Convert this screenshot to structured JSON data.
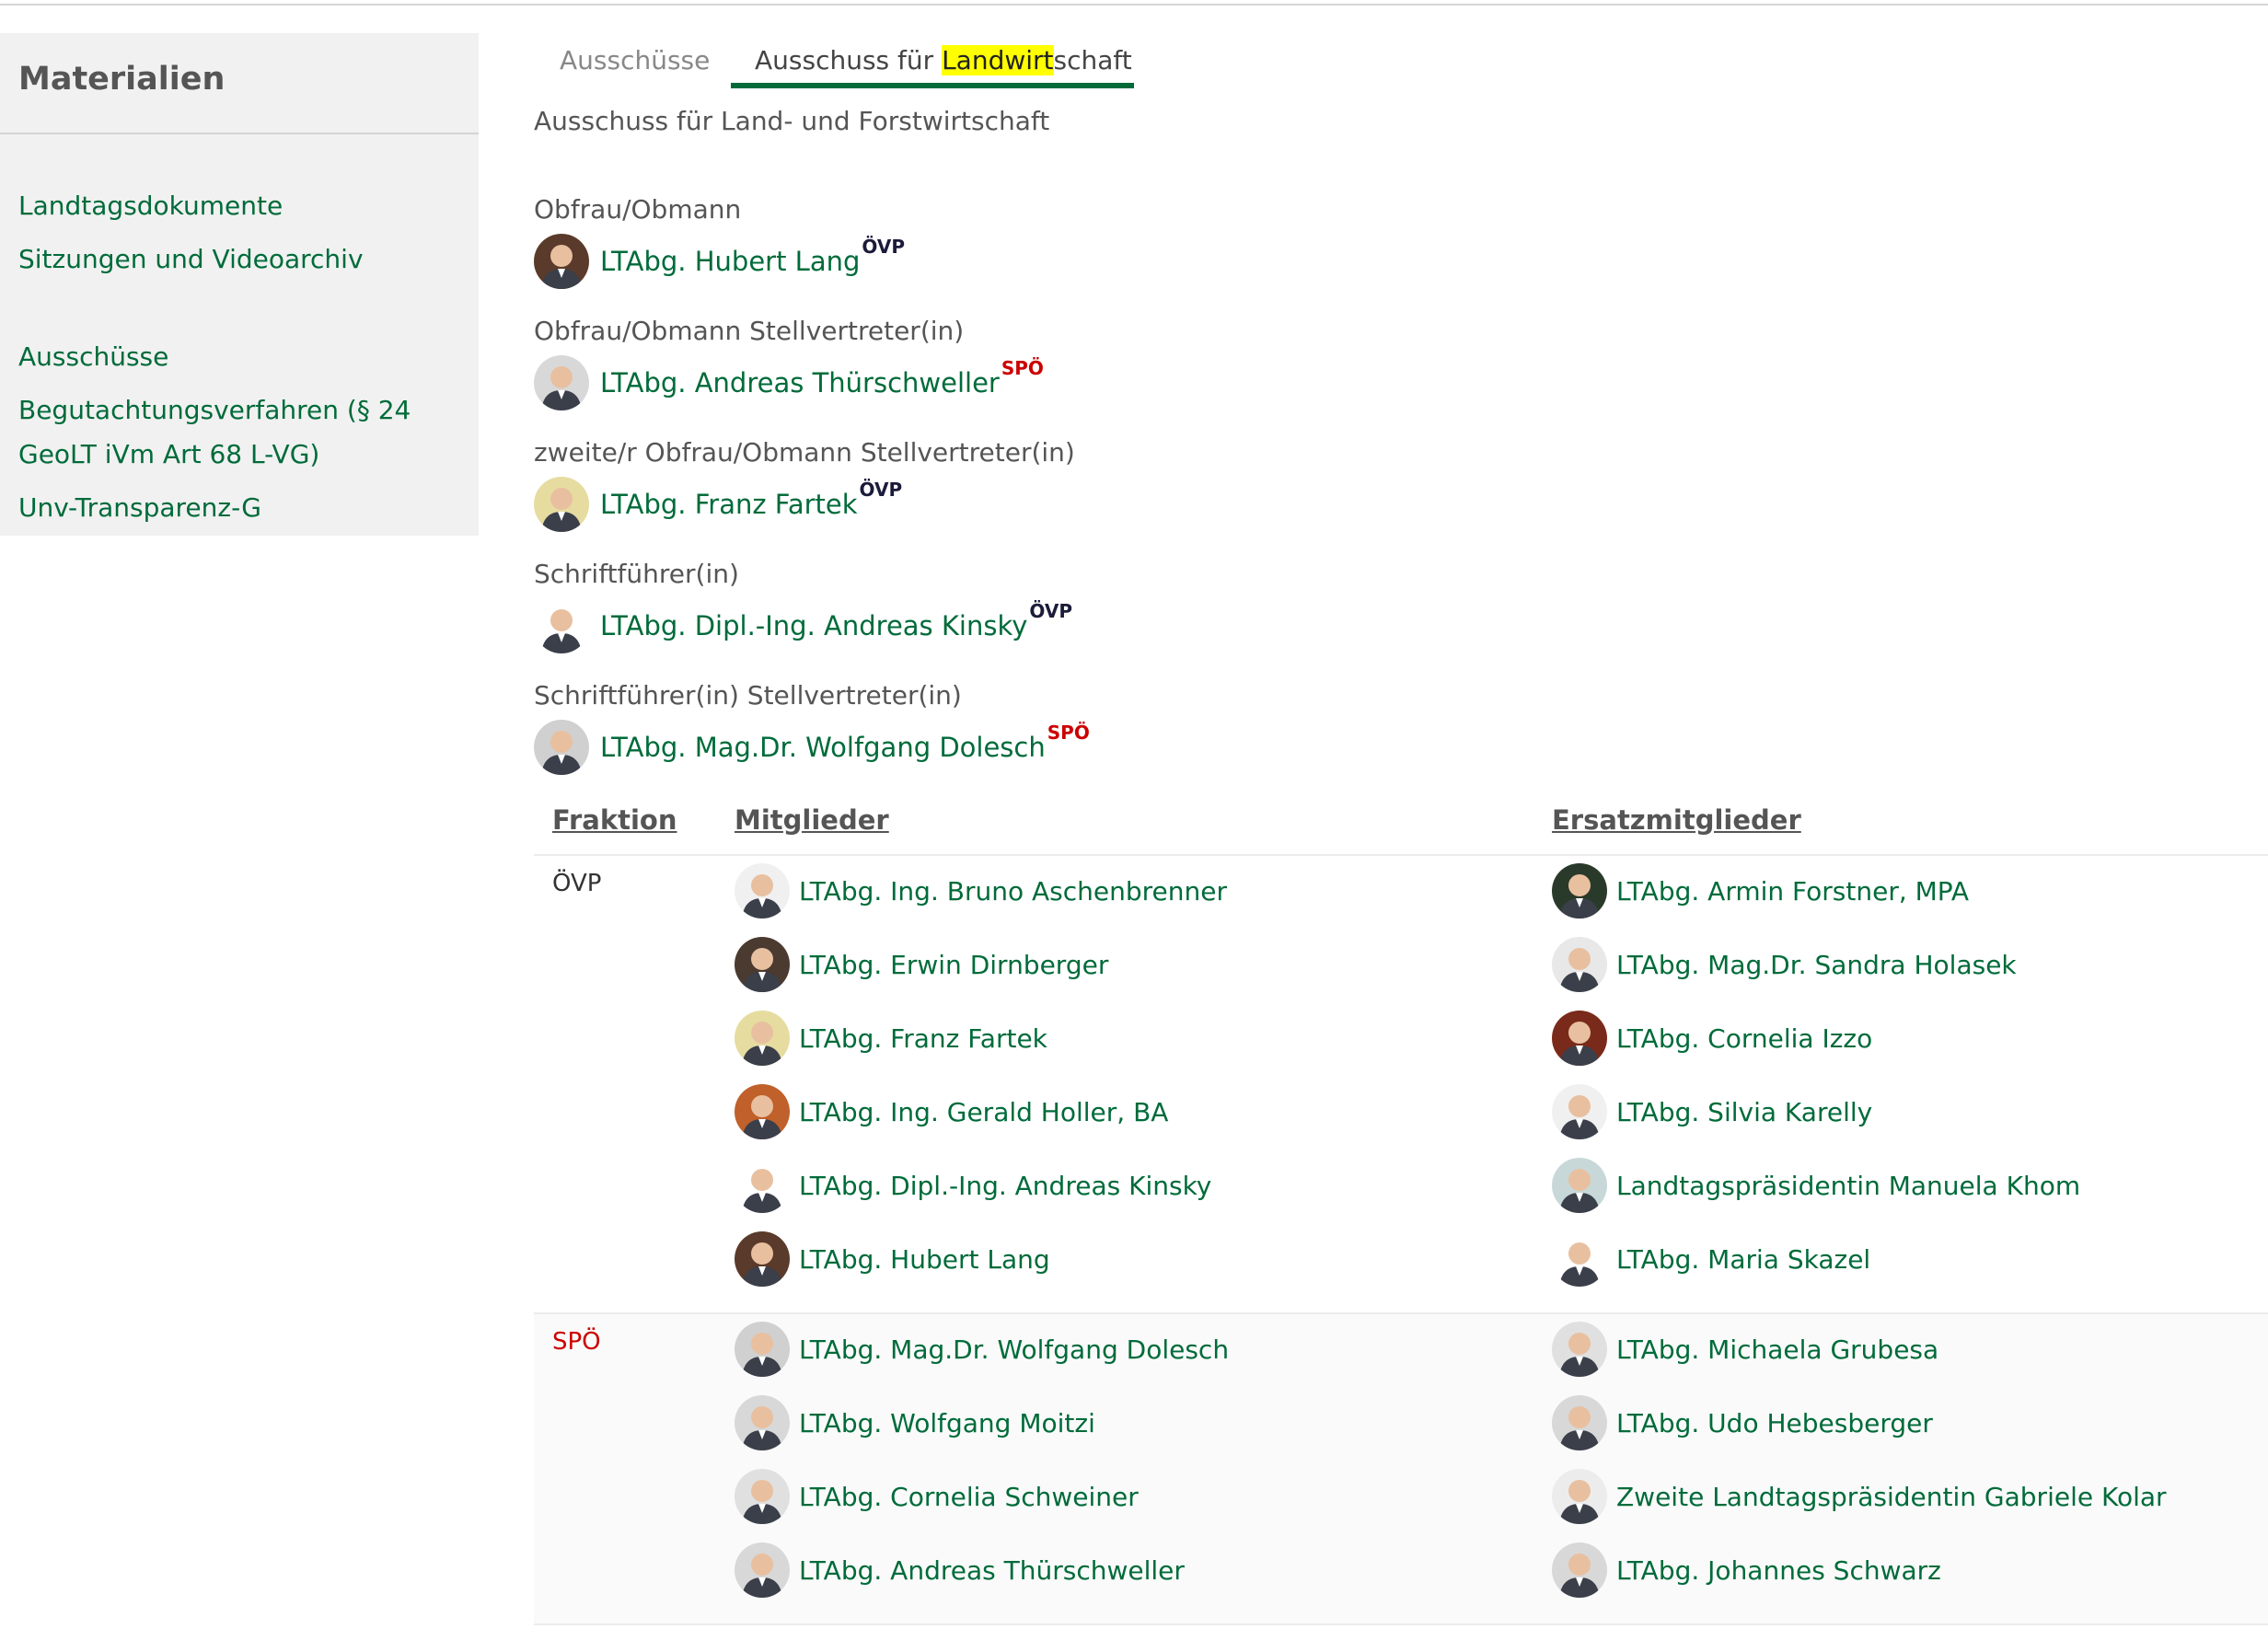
{
  "sidebar": {
    "title": "Materialien",
    "links": [
      "Landtagsdokumente",
      "Sitzungen und Videoarchiv",
      "Ausschüsse",
      "Begutachtungsverfahren (§ 24",
      "GeoLT iVm Art 68 L-VG)",
      "Unv-Transparenz-G"
    ]
  },
  "tabs": {
    "inactive": "Ausschüsse",
    "active_prefix": "Ausschuss für ",
    "active_highlight": "Landwirt",
    "active_suffix": "schaft"
  },
  "subtitle": "Ausschuss für Land- und Forstwirtschaft",
  "roles": [
    {
      "label": "Obfrau/Obmann",
      "name": "LTAbg. Hubert Lang",
      "party": "ÖVP"
    },
    {
      "label": "Obfrau/Obmann Stellvertreter(in)",
      "name": "LTAbg. Andreas Thürschweller",
      "party": "SPÖ"
    },
    {
      "label": "zweite/r Obfrau/Obmann Stellvertreter(in)",
      "name": "LTAbg. Franz Fartek",
      "party": "ÖVP"
    },
    {
      "label": "Schriftführer(in)",
      "name": "LTAbg. Dipl.-Ing. Andreas Kinsky",
      "party": "ÖVP"
    },
    {
      "label": "Schriftführer(in) Stellvertreter(in)",
      "name": "LTAbg. Mag.Dr. Wolfgang Dolesch",
      "party": "SPÖ"
    }
  ],
  "table": {
    "headers": [
      "Fraktion",
      "Mitglieder",
      "Ersatzmitglieder"
    ],
    "groups": [
      {
        "fraktion": "ÖVP",
        "color": "#333333",
        "mitglieder": [
          "LTAbg. Ing. Bruno Aschenbrenner",
          "LTAbg. Erwin Dirnberger",
          "LTAbg. Franz Fartek",
          "LTAbg. Ing. Gerald Holler, BA",
          "LTAbg. Dipl.-Ing. Andreas Kinsky",
          "LTAbg. Hubert Lang"
        ],
        "ersatz": [
          "LTAbg. Armin Forstner, MPA",
          "LTAbg. Mag.Dr. Sandra Holasek",
          "LTAbg. Cornelia Izzo",
          "LTAbg. Silvia Karelly",
          "Landtagspräsidentin Manuela Khom",
          "LTAbg. Maria Skazel"
        ]
      },
      {
        "fraktion": "SPÖ",
        "color": "#cc0000",
        "mitglieder": [
          "LTAbg. Mag.Dr. Wolfgang Dolesch",
          "LTAbg. Wolfgang Moitzi",
          "LTAbg. Cornelia Schweiner",
          "LTAbg. Andreas Thürschweller"
        ],
        "ersatz": [
          "LTAbg. Michaela Grubesa",
          "LTAbg. Udo Hebesberger",
          "Zweite Landtagspräsidentin Gabriele Kolar",
          "LTAbg. Johannes Schwarz"
        ]
      }
    ]
  },
  "colors": {
    "link": "#006b3a",
    "accent": "#006b3a",
    "highlight": "#ffff00",
    "spoe": "#cc0000",
    "oevp": "#1b1b3a"
  }
}
